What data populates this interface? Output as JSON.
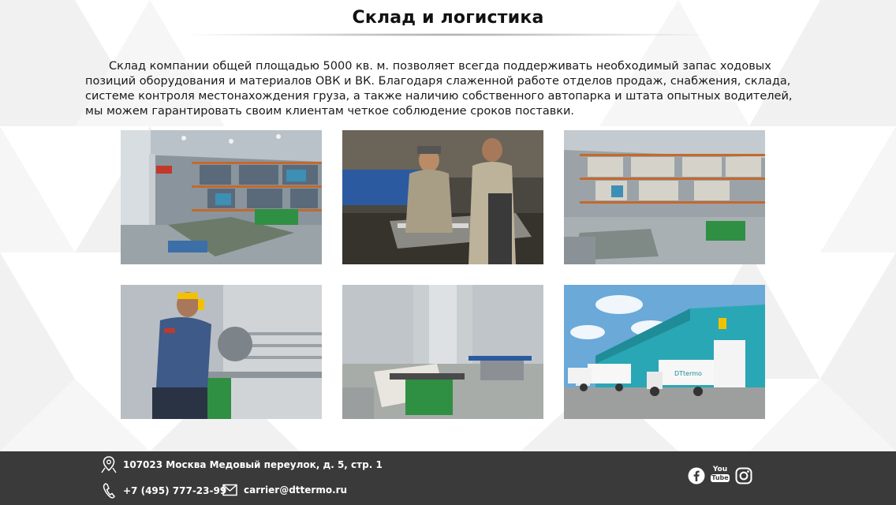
{
  "page": {
    "title": "Склад и логистика",
    "intro": "Склад компании общей площадью 5000 кв. м. позволяет всегда поддерживать необходимый запас ходовых позиций оборудования и материалов ОВК и ВК. Благодаря слаженной работе отделов продаж, снабжения, склада, системе контроля местонахождения груза, а также наличию собственного автопарка и штата опытных водителей, мы можем гарантировать своим клиентам четкое соблюдение сроков поставки."
  },
  "photos": {
    "truck_brand": "DTtermo"
  },
  "footer": {
    "address": "107023 Москва Медовый переулок, д. 5, стр. 1",
    "phone": "+7 (495) 777-23-99",
    "email": "carrier@dttermo.ru",
    "youtube_top": "You",
    "youtube_bottom": "Tube"
  },
  "icons": {
    "address": "map-pin-icon",
    "phone": "phone-icon",
    "email": "mail-icon",
    "facebook": "facebook-icon",
    "youtube": "youtube-icon",
    "instagram": "instagram-icon"
  },
  "colors": {
    "footer_bg": "#3a3a3a",
    "text": "#1a1a1a",
    "warehouse_wall": "#2aa7b5"
  }
}
